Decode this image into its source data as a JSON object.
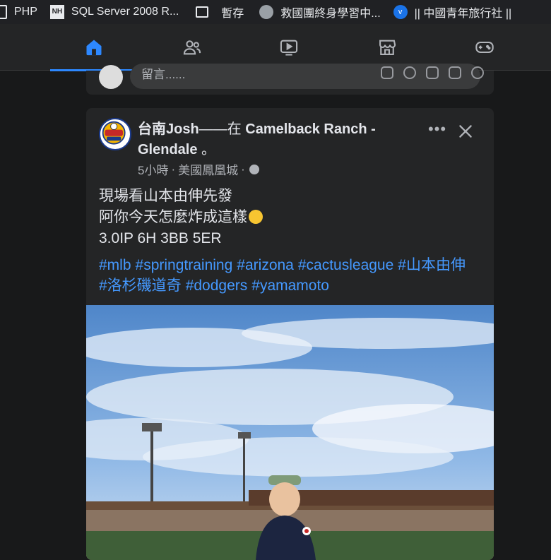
{
  "bookmarks": [
    {
      "icon": "document-icon",
      "label": "PHP"
    },
    {
      "icon": "nh-icon",
      "label": "SQL Server 2008 R..."
    },
    {
      "icon": "folder-icon",
      "label": "暫存"
    },
    {
      "icon": "globe-icon",
      "label": "救國團終身學習中..."
    },
    {
      "icon": "bookmark-icon",
      "label": "|| 中國青年旅行社 ||"
    }
  ],
  "nav": {
    "tabs": [
      "home",
      "friends",
      "watch",
      "marketplace",
      "gaming"
    ],
    "active": "home"
  },
  "composer": {
    "placeholder": "留言......"
  },
  "post": {
    "author": "台南Josh",
    "connector": "——在 ",
    "location_name": "Camelback Ranch - Glendale",
    "suffix": " 。",
    "time": "5小時",
    "place": "美國鳳凰城",
    "text_lines": [
      "現場看山本由伸先發",
      "阿你今天怎麼炸成這樣",
      "3.0IP 6H 3BB 5ER"
    ],
    "hashtags": [
      "#mlb",
      "#springtraining",
      "#arizona",
      "#cactusleague",
      "#山本由伸",
      "#洛杉磯道奇",
      "#dodgers",
      "#yamamoto"
    ],
    "more_label": "•••"
  },
  "colors": {
    "accent": "#2d88ff",
    "hashtag": "#4599ff",
    "background": "#18191a",
    "card": "#242526"
  }
}
